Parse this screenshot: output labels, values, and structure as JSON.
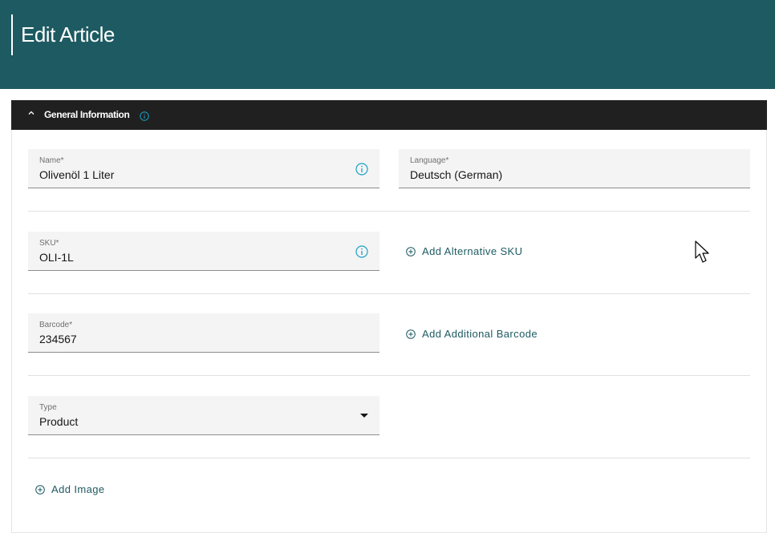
{
  "header": {
    "title": "Edit Article"
  },
  "section": {
    "title": "General Information",
    "info_icon": "info-icon",
    "collapse_icon": "chevron-up-icon"
  },
  "fields": {
    "name": {
      "label": "Name*",
      "value": "Olivenöl 1 Liter"
    },
    "language": {
      "label": "Language*",
      "value": "Deutsch (German)"
    },
    "sku": {
      "label": "SKU*",
      "value": "OLI-1L"
    },
    "barcode": {
      "label": "Barcode*",
      "value": "234567"
    },
    "type": {
      "label": "Type",
      "value": "Product"
    }
  },
  "actions": {
    "add_alt_sku": "Add Alternative SKU",
    "add_barcode": "Add Additional Barcode",
    "add_image": "Add Image"
  },
  "colors": {
    "header_bg": "#1d5a61",
    "panel_head_bg": "#202020",
    "accent_info": "#1aa1c9",
    "link": "#1d5a61"
  }
}
